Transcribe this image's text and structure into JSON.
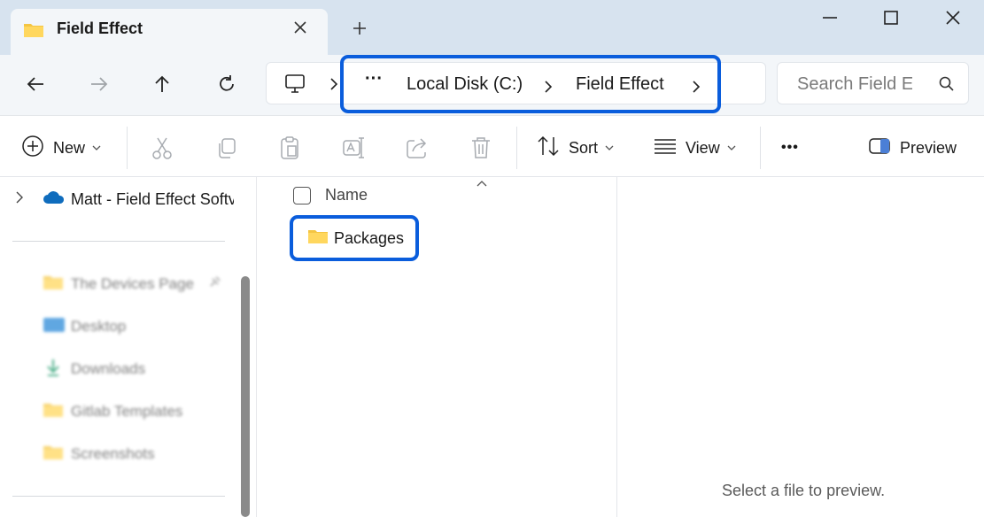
{
  "tab": {
    "title": "Field Effect",
    "close_icon": "close-icon",
    "new_tab_icon": "plus-icon"
  },
  "window": {
    "minimize_icon": "minimize-icon",
    "maximize_icon": "maximize-icon",
    "close_icon": "close-icon"
  },
  "nav": {
    "back_icon": "arrow-left-icon",
    "forward_icon": "arrow-right-icon",
    "up_icon": "arrow-up-icon",
    "refresh_icon": "refresh-icon"
  },
  "breadcrumb": {
    "root_icon": "monitor-icon",
    "overflow": "···",
    "items": [
      "Local Disk (C:)",
      "Field Effect"
    ],
    "highlight_color": "#0a5ddc"
  },
  "search": {
    "placeholder": "Search Field E"
  },
  "toolbar": {
    "new_label": "New",
    "sort_label": "Sort",
    "view_label": "View",
    "more_label": "•••",
    "preview_label": "Preview",
    "icons": [
      "cut-icon",
      "copy-icon",
      "paste-icon",
      "rename-icon",
      "share-icon",
      "delete-icon"
    ]
  },
  "sidebar": {
    "cloud_item": "Matt - Field Effect Softv",
    "quick_access": [
      {
        "label": "The Devices Page",
        "icon": "folder-icon"
      },
      {
        "label": "Desktop",
        "icon": "desktop-icon"
      },
      {
        "label": "Downloads",
        "icon": "download-icon"
      },
      {
        "label": "Gitlab Templates",
        "icon": "folder-icon"
      },
      {
        "label": "Screenshots",
        "icon": "folder-icon"
      }
    ]
  },
  "content": {
    "column_name": "Name",
    "items": [
      {
        "label": "Packages",
        "icon": "folder-icon"
      }
    ]
  },
  "preview": {
    "message": "Select a file to preview."
  }
}
